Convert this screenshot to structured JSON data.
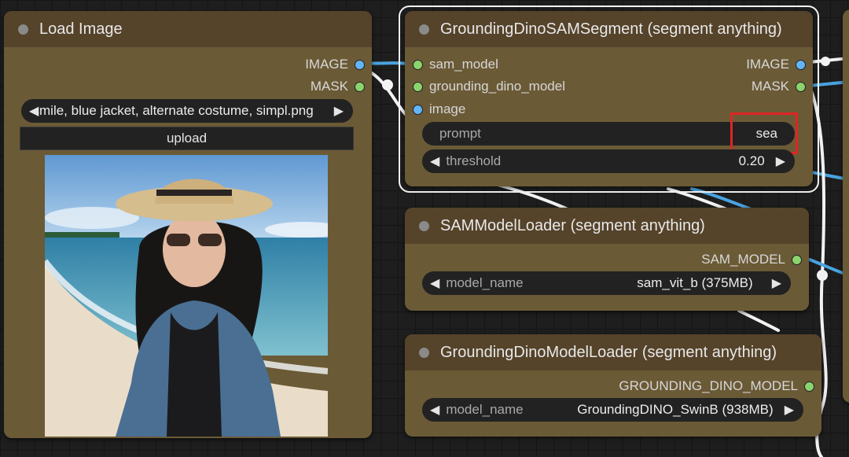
{
  "load_image": {
    "title": "Load Image",
    "outputs": [
      "IMAGE",
      "MASK"
    ],
    "filename": "ket, smile, blue jacket, alternate costume, simpl.png",
    "upload_label": "upload"
  },
  "sam_segment": {
    "title": "GroundingDinoSAMSegment (segment anything)",
    "inputs": [
      "sam_model",
      "grounding_dino_model",
      "image"
    ],
    "outputs": [
      "IMAGE",
      "MASK"
    ],
    "prompt_label": "prompt",
    "prompt_value": "sea",
    "threshold_label": "threshold",
    "threshold_value": "0.20"
  },
  "sam_loader": {
    "title": "SAMModelLoader (segment anything)",
    "output": "SAM_MODEL",
    "model_label": "model_name",
    "model_value": "sam_vit_b (375MB)"
  },
  "dino_loader": {
    "title": "GroundingDinoModelLoader (segment anything)",
    "output": "GROUNDING_DINO_MODEL",
    "model_label": "model_name",
    "model_value": "GroundingDINO_SwinB (938MB)"
  },
  "icons": {
    "left_arrow": "◀",
    "right_arrow": "▶"
  },
  "colors": {
    "node_body": "#6b5a36",
    "node_title": "#55432a",
    "image_slot": "#64b5f6",
    "mask_slot": "#8bd36c",
    "highlight": "#e02424"
  }
}
